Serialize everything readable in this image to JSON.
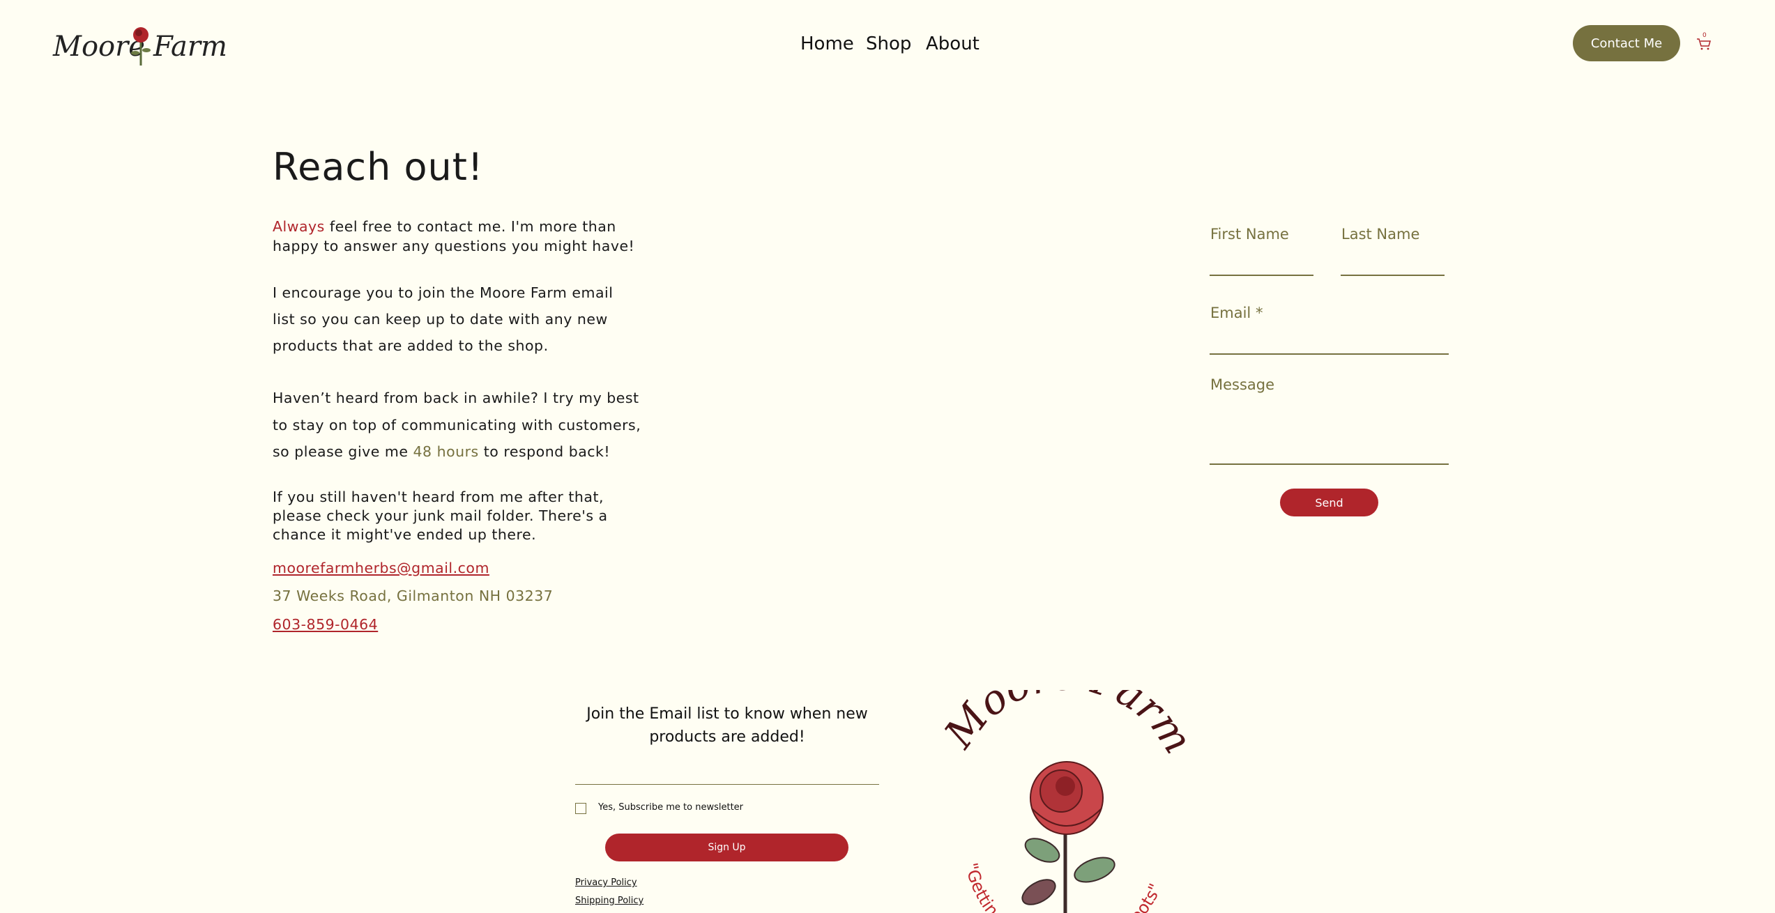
{
  "header": {
    "logo_text": "Moore Farm",
    "nav": [
      "Home",
      "Shop",
      "About"
    ],
    "contact_button": "Contact Me",
    "cart_count": "0"
  },
  "main": {
    "title": "Reach out!",
    "p1_highlight": "Always",
    "p1_line1_rest": " feel free to contact me. I'm more than",
    "p1_line2": "happy to answer any questions you might have!",
    "p2_lines": [
      "I encourage you to join the Moore Farm email",
      "list so you can keep up to date with any new",
      "products that are added to the shop."
    ],
    "p3_line1": "Haven’t heard from back in awhile? I try my best",
    "p3_line2": "to stay on top of communicating with customers,",
    "p3_line3_a": "so please give me ",
    "p3_line3_highlight": "48 hours",
    "p3_line3_b": " to respond back!",
    "p4_lines": [
      "If you still haven't heard from me after that,",
      "please check your junk mail folder. There's a",
      "chance it might've ended up there."
    ],
    "email": "moorefarmherbs@gmail.com",
    "address": "37 Weeks Road, Gilmanton NH 03237",
    "phone": "603-859-0464"
  },
  "form": {
    "first_name_label": "First Name",
    "last_name_label": "Last Name",
    "email_label": "Email *",
    "message_label": "Message",
    "send_button": "Send"
  },
  "footer": {
    "signup_heading_line1": "Join the Email list to know when new",
    "signup_heading_line2": "products are added!",
    "checkbox_label": "Yes, Subscribe me to newsletter",
    "signup_button": "Sign Up",
    "links": [
      "Privacy Policy",
      "Shipping Policy"
    ],
    "logo_title": "Moore Farm",
    "logo_tagline_left": "\"Gettin",
    "logo_tagline_right": "Roots\""
  },
  "colors": {
    "background": "#fffef3",
    "olive": "#76713f",
    "red": "#b0252b"
  }
}
